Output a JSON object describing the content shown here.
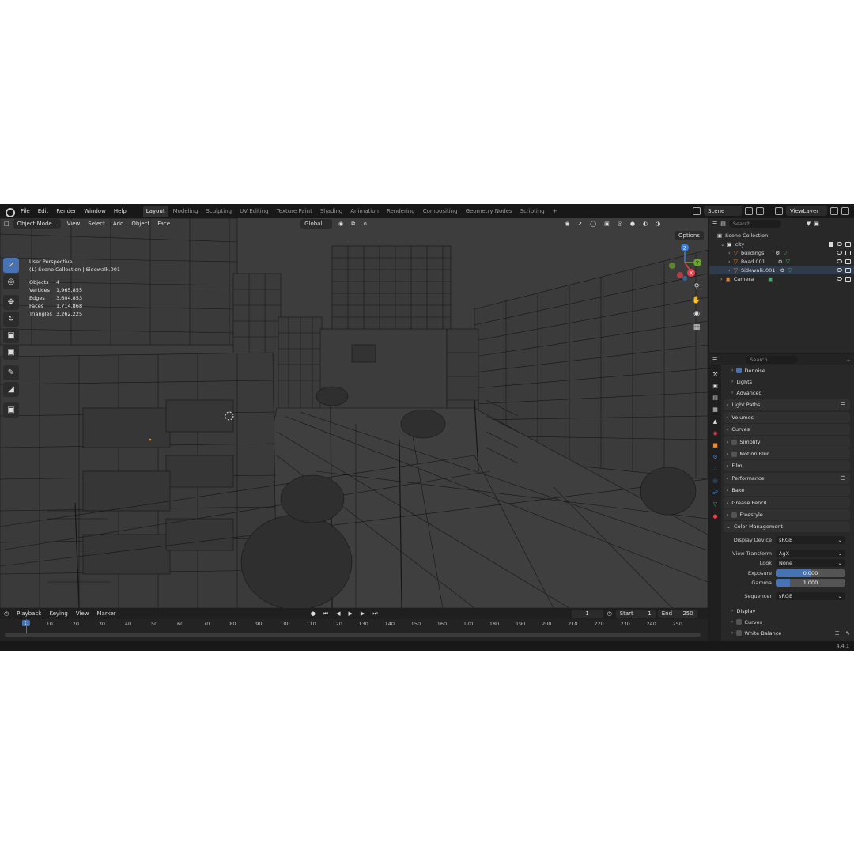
{
  "menu": [
    "File",
    "Edit",
    "Render",
    "Window",
    "Help"
  ],
  "workspaces": [
    "Layout",
    "Modeling",
    "Sculpting",
    "UV Editing",
    "Texture Paint",
    "Shading",
    "Animation",
    "Rendering",
    "Compositing",
    "Geometry Nodes",
    "Scripting"
  ],
  "active_workspace": "Layout",
  "add_tab": "+",
  "scene_name": "Scene",
  "view_layer": "ViewLayer",
  "viewport": {
    "mode": "Object Mode",
    "menus": [
      "View",
      "Select",
      "Add",
      "Object",
      "Face"
    ],
    "orientation": "Global",
    "options": "Options",
    "view_name": "User Perspective",
    "collection_info": "(1) Scene Collection | Sidewalk.001",
    "stats": [
      {
        "label": "Objects",
        "value": "4"
      },
      {
        "label": "Vertices",
        "value": "1,965,855"
      },
      {
        "label": "Edges",
        "value": "3,604,853"
      },
      {
        "label": "Faces",
        "value": "1,714,868"
      },
      {
        "label": "Triangles",
        "value": "3,262,225"
      }
    ],
    "gizmo_axes": {
      "z": "Z",
      "y": "Y",
      "x": "X"
    },
    "colors": {
      "x_axis": "#e0424d",
      "y_axis": "#6aa62a",
      "z_axis": "#3a7fd6",
      "wire": "#101010"
    }
  },
  "timeline": {
    "menus": [
      "Playback",
      "Keying",
      "View",
      "Marker"
    ],
    "current_frame": "1",
    "start_label": "Start",
    "start": "1",
    "end_label": "End",
    "end": "250",
    "ruler_marks": [
      "10",
      "20",
      "30",
      "40",
      "50",
      "60",
      "70",
      "80",
      "90",
      "100",
      "110",
      "120",
      "130",
      "140",
      "150",
      "160",
      "170",
      "180",
      "190",
      "200",
      "210",
      "220",
      "230",
      "240",
      "250"
    ],
    "ruler_current": "1"
  },
  "outliner": {
    "search_placeholder": "Search",
    "rows": [
      {
        "label": "Scene Collection"
      },
      {
        "label": "city"
      },
      {
        "label": "buildings"
      },
      {
        "label": "Road.001"
      },
      {
        "label": "Sidewalk.001"
      },
      {
        "label": "Camera"
      }
    ]
  },
  "properties": {
    "search_placeholder": "Search",
    "denoise": "Denoise",
    "lights": "Lights",
    "advanced": "Advanced",
    "panels": [
      "Light Paths",
      "Volumes",
      "Curves",
      "Simplify",
      "Motion Blur",
      "Film",
      "Performance",
      "Bake",
      "Grease Pencil",
      "Freestyle",
      "Color Management"
    ],
    "color_management": {
      "display_device_label": "Display Device",
      "display_device": "sRGB",
      "view_transform_label": "View Transform",
      "view_transform": "AgX",
      "look_label": "Look",
      "look": "None",
      "exposure_label": "Exposure",
      "exposure": "0.000",
      "exposure_fill": 0.5,
      "gamma_label": "Gamma",
      "gamma": "1.000",
      "gamma_fill": 0.2,
      "sequencer_label": "Sequencer",
      "sequencer": "sRGB"
    },
    "subpanels": [
      "Display",
      "Curves",
      "White Balance"
    ]
  },
  "version": "4.4.1",
  "accent": "#4772b3"
}
